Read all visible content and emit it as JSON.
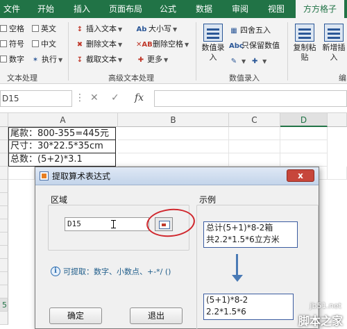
{
  "tabs": [
    "文件",
    "开始",
    "插入",
    "页面布局",
    "公式",
    "数据",
    "审阅",
    "视图",
    "方方格子"
  ],
  "ribbon": {
    "text_group": {
      "checks": [
        "空格",
        "英文",
        "符号",
        "中文",
        "数字"
      ],
      "execute": "执行",
      "label": "文本处理"
    },
    "adv_group": {
      "insert_text": "插入文本",
      "delete_text": "删除文本",
      "cut_text": "截取文本",
      "case": "大小写",
      "delete_space": "删除空格",
      "more": "更多",
      "label": "高级文本处理"
    },
    "num_group": {
      "value_entry": "数值录入",
      "round": "四舍五入",
      "keep_value": "只保留数值",
      "label": "数值录入"
    },
    "right_group": {
      "copy_paste": "复制粘贴",
      "new_insert": "新增插入",
      "edit_label": "编"
    }
  },
  "formula_bar": {
    "cell_ref": "D15",
    "fx": "fx"
  },
  "grid": {
    "columns": [
      "A",
      "B",
      "C",
      "D"
    ],
    "selected_column": "D",
    "cells": [
      "尾款：800-355=445元",
      "尺寸：30*22.5*35cm",
      "总数：(5+2)*3.1"
    ],
    "visible_row_numbers": [
      "5"
    ]
  },
  "dialog": {
    "title": "提取算术表达式",
    "close": "x",
    "range_label": "区域",
    "range_value": "D15",
    "example_label": "示例",
    "example_inputs": [
      "总计(5+1)*8-2箱",
      "共2.2*1.5*6立方米"
    ],
    "example_outputs": [
      "(5+1)*8-2",
      "2.2*1.5*6"
    ],
    "info_icon": "i",
    "info_text": "可提取：数字、小数点、+-*/ ()",
    "ok": "确定",
    "exit": "退出"
  },
  "watermark": {
    "line1": "jb51.net",
    "line2": "脚本之家"
  },
  "colors": {
    "excel_green": "#217346",
    "annotation_red": "#d0282e",
    "arrow_blue": "#4a7ab5"
  }
}
